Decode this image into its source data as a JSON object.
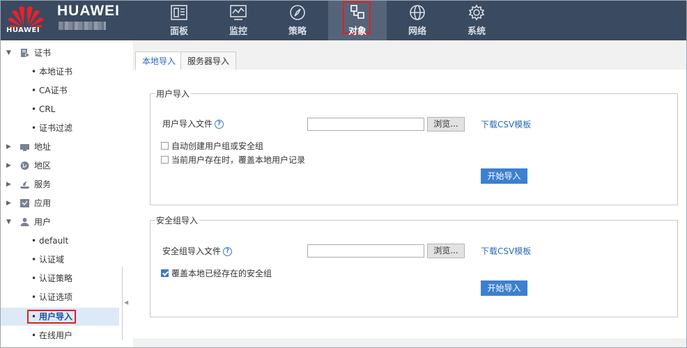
{
  "header": {
    "brand": "HUAWEI",
    "logo_text": "HUAWEI",
    "nav": [
      {
        "label": "面板",
        "icon": "dashboard-icon"
      },
      {
        "label": "监控",
        "icon": "monitor-icon"
      },
      {
        "label": "策略",
        "icon": "compass-icon"
      },
      {
        "label": "对象",
        "icon": "object-icon",
        "active": true
      },
      {
        "label": "网络",
        "icon": "globe-icon"
      },
      {
        "label": "系统",
        "icon": "gear-icon"
      }
    ]
  },
  "sidebar": {
    "items": [
      {
        "label": "证书",
        "type": "group",
        "expanded": true,
        "icon": "certificate-icon"
      },
      {
        "label": "本地证书",
        "type": "child"
      },
      {
        "label": "CA证书",
        "type": "child"
      },
      {
        "label": "CRL",
        "type": "child"
      },
      {
        "label": "证书过滤",
        "type": "child"
      },
      {
        "label": "地址",
        "type": "group",
        "expanded": false,
        "icon": "address-icon"
      },
      {
        "label": "地区",
        "type": "group",
        "expanded": false,
        "icon": "region-icon"
      },
      {
        "label": "服务",
        "type": "group",
        "expanded": false,
        "icon": "service-icon"
      },
      {
        "label": "应用",
        "type": "group",
        "expanded": false,
        "icon": "application-icon"
      },
      {
        "label": "用户",
        "type": "group",
        "expanded": true,
        "icon": "user-icon"
      },
      {
        "label": "default",
        "type": "child"
      },
      {
        "label": "认证域",
        "type": "child"
      },
      {
        "label": "认证策略",
        "type": "child"
      },
      {
        "label": "认证选项",
        "type": "child"
      },
      {
        "label": "用户导入",
        "type": "child",
        "selected": true
      },
      {
        "label": "在线用户",
        "type": "child"
      }
    ]
  },
  "tabs": [
    {
      "label": "本地导入",
      "active": true
    },
    {
      "label": "服务器导入",
      "active": false
    }
  ],
  "user_import": {
    "legend": "用户导入",
    "file_label": "用户导入文件",
    "file_value": "",
    "browse_label": "浏览...",
    "template_link": "下载CSV模板",
    "option1": {
      "label": "自动创建用户组或安全组",
      "checked": false
    },
    "option2": {
      "label": "当前用户存在时，覆盖本地用户记录",
      "checked": false
    },
    "start_label": "开始导入"
  },
  "group_import": {
    "legend": "安全组导入",
    "file_label": "安全组导入文件",
    "file_value": "",
    "browse_label": "浏览...",
    "template_link": "下载CSV模板",
    "option1": {
      "label": "覆盖本地已经存在的安全组",
      "checked": true
    },
    "start_label": "开始导入"
  },
  "colors": {
    "topbar": "#3a4a60",
    "accent": "#3d7fd0",
    "highlight": "#e02020"
  }
}
